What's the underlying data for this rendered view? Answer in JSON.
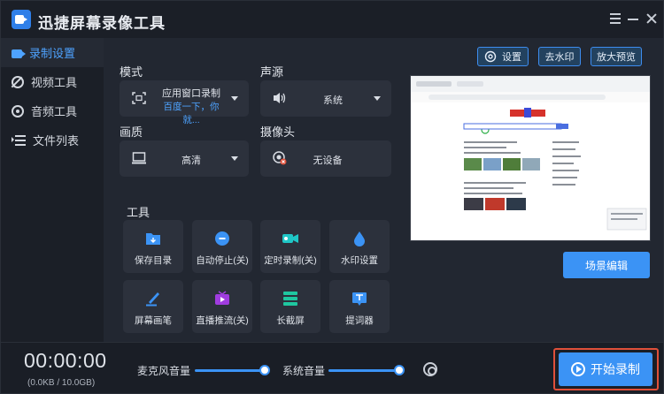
{
  "app": {
    "title": "迅捷屏幕录像工具",
    "accent_color": "#3b93f5",
    "window_controls": [
      "menu-icon",
      "minimize-icon",
      "close-icon"
    ]
  },
  "sidebar": {
    "items": [
      {
        "label": "录制设置",
        "icon": "camera-icon",
        "active": true
      },
      {
        "label": "视频工具",
        "icon": "video-tool-icon",
        "active": false
      },
      {
        "label": "音频工具",
        "icon": "audio-tool-icon",
        "active": false
      },
      {
        "label": "文件列表",
        "icon": "file-list-icon",
        "active": false
      }
    ]
  },
  "settings": {
    "mode": {
      "label": "模式",
      "value": "应用窗口录制",
      "sub_value": "百度一下，你就...",
      "icon": "window-capture-icon"
    },
    "audio_source": {
      "label": "声源",
      "value": "系统",
      "icon": "speaker-icon"
    },
    "quality": {
      "label": "画质",
      "value": "高清",
      "icon": "monitor-icon"
    },
    "camera": {
      "label": "摄像头",
      "value": "无设备",
      "icon": "camera-off-icon"
    }
  },
  "tools": {
    "label": "工具",
    "items": [
      {
        "label": "保存目录",
        "icon": "folder-icon"
      },
      {
        "label": "自动停止(关)",
        "icon": "auto-stop-icon"
      },
      {
        "label": "定时录制(关)",
        "icon": "timer-record-icon"
      },
      {
        "label": "水印设置",
        "icon": "watermark-drop-icon"
      },
      {
        "label": "屏幕画笔",
        "icon": "pen-icon"
      },
      {
        "label": "直播推流(关)",
        "icon": "live-stream-icon"
      },
      {
        "label": "长截屏",
        "icon": "long-screenshot-icon"
      },
      {
        "label": "提词器",
        "icon": "prompter-icon"
      }
    ]
  },
  "top_buttons": {
    "settings": "设置",
    "remove_watermark": "去水印",
    "enlarge_preview": "放大预览"
  },
  "scene_edit": "场景编辑",
  "bottom": {
    "timer": "00:00:00",
    "size": "(0.0KB / 10.0GB)",
    "mic_volume_label": "麦克风音量",
    "mic_volume": 1.0,
    "system_volume_label": "系统音量",
    "system_volume": 1.0,
    "start_record": "开始录制"
  }
}
